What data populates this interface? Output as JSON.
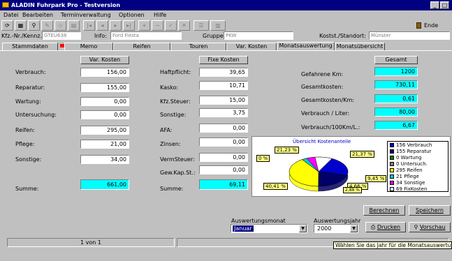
{
  "window": {
    "title": "ALADIN Fuhrpark Pro - Testversion",
    "controls": [
      "_",
      "□"
    ]
  },
  "menu": [
    "Datei",
    "Bearbeiten",
    "Terminverwaltung",
    "Optionen",
    "Hilfe"
  ],
  "toolbar": {
    "icons": [
      "new-icon",
      "preview-icon",
      "find-icon",
      "wizard-icon",
      "eraser-icon",
      "table-icon",
      "first-icon",
      "prev-icon",
      "next-icon",
      "last-icon",
      "add-icon",
      "delete-icon",
      "edit-icon",
      "cancel-icon",
      "list-icon",
      "chart-icon"
    ],
    "ende_label": "Ende"
  },
  "header": {
    "kfz_label": "Kfz.-Nr./Kennz.",
    "kfz_value": "GTEU638",
    "info_label": "Info:",
    "info_value": "Ford Fiesta",
    "gruppe_label": "Gruppe:",
    "gruppe_value": "PKW",
    "kost_label": "Kostst./Standort:",
    "kost_value": "Münster"
  },
  "tabs": [
    "Stammdaten",
    "Memo",
    "Reifen",
    "Touren",
    "Var. Kosten",
    "Monatsauswertung",
    "Monatsübersicht"
  ],
  "var": {
    "header": "Var. Kosten",
    "rows": [
      {
        "label": "Verbrauch:",
        "value": "156,00"
      },
      {
        "label": "Reparatur:",
        "value": "155,00"
      },
      {
        "label": "Wartung:",
        "value": "0,00"
      },
      {
        "label": "Untersuchung:",
        "value": "0,00"
      },
      {
        "label": "Reifen:",
        "value": "295,00"
      },
      {
        "label": "Pflege:",
        "value": "21,00"
      },
      {
        "label": "Sonstige:",
        "value": "34,00"
      }
    ],
    "sum_label": "Summe:",
    "sum_value": "661,00"
  },
  "fix": {
    "header": "Fixe Kosten",
    "rows": [
      {
        "label": "Haftpflicht:",
        "value": "39,65"
      },
      {
        "label": "Kasko:",
        "value": "10,71"
      },
      {
        "label": "Kfz.Steuer:",
        "value": "15,00"
      },
      {
        "label": "Sonstige:",
        "value": "3,75"
      },
      {
        "label": "AFA:",
        "value": "0,00"
      },
      {
        "label": "Zinsen:",
        "value": "0,00"
      },
      {
        "label": "VermSteuer:",
        "value": "0,00"
      },
      {
        "label": "Gew.Kap.St.:",
        "value": "0,00"
      }
    ],
    "sum_label": "Summe:",
    "sum_value": "69,11"
  },
  "gesamt": {
    "header": "Gesamt",
    "rows": [
      {
        "label": "Gefahrene Km:",
        "value": "1200"
      },
      {
        "label": "Gesamtkosten:",
        "value": "730,11"
      },
      {
        "label": "Gesamtkosten/Km:",
        "value": "0,61"
      },
      {
        "label": "Verbrauch / Liter:",
        "value": "80,00"
      },
      {
        "label": "Verbrauch/100Km/L.:",
        "value": "6,67"
      }
    ]
  },
  "chart_data": {
    "type": "pie",
    "title": "Übersicht Kostenanteile",
    "slices": [
      {
        "legend": "156 Verbrauch",
        "value": 156,
        "color": "#0000cc",
        "pct_label": "21,37 %"
      },
      {
        "legend": "155 Reparatur",
        "value": 155,
        "color": "#000066",
        "pct_label": "21,23 %"
      },
      {
        "legend": "0 Wartung",
        "value": 0,
        "color": "#008000",
        "pct_label": "0 %"
      },
      {
        "legend": "0 Untersuch.",
        "value": 0,
        "color": "#808080",
        "pct_label": ""
      },
      {
        "legend": "295 Reifen",
        "value": 295,
        "color": "#ffff00",
        "pct_label": "40,41 %"
      },
      {
        "legend": "21 Pflege",
        "value": 21,
        "color": "#00cccc",
        "pct_label": "2,88 %"
      },
      {
        "legend": "34 Sonstige",
        "value": 34,
        "color": "#ff00ff",
        "pct_label": "4,66 %"
      },
      {
        "legend": "69 FixKosten",
        "value": 69,
        "color": "#ffffff",
        "pct_label": "9,45 %"
      }
    ]
  },
  "actions": {
    "berechnen": "Berechnen",
    "speichern": "Speichern",
    "drucken": "Drucken",
    "vorschau": "Vorschau"
  },
  "filters": {
    "monat_label": "Auswertungsmonat",
    "monat_value": "Januar",
    "jahr_label": "Auswertungsjahr",
    "jahr_value": "2000"
  },
  "status": {
    "record": "1 von 1",
    "tooltip": "Wählen Sie das Jahr für die Monatsauswertung"
  }
}
